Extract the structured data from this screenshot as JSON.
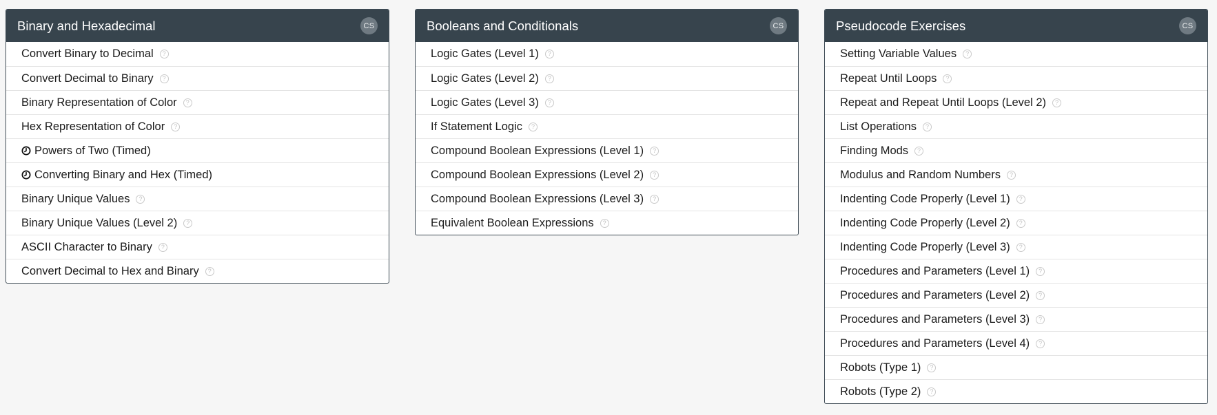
{
  "panels": [
    {
      "title": "Binary and Hexadecimal",
      "badge": "CS",
      "items": [
        {
          "label": "Convert Binary to Decimal",
          "help": true,
          "timed": false
        },
        {
          "label": "Convert Decimal to Binary",
          "help": true,
          "timed": false
        },
        {
          "label": "Binary Representation of Color",
          "help": true,
          "timed": false
        },
        {
          "label": "Hex Representation of Color",
          "help": true,
          "timed": false
        },
        {
          "label": "Powers of Two (Timed)",
          "help": false,
          "timed": true
        },
        {
          "label": "Converting Binary and Hex (Timed)",
          "help": false,
          "timed": true
        },
        {
          "label": "Binary Unique Values",
          "help": true,
          "timed": false
        },
        {
          "label": "Binary Unique Values (Level 2)",
          "help": true,
          "timed": false
        },
        {
          "label": "ASCII Character to Binary",
          "help": true,
          "timed": false
        },
        {
          "label": "Convert Decimal to Hex and Binary",
          "help": true,
          "timed": false
        }
      ]
    },
    {
      "title": "Booleans and Conditionals",
      "badge": "CS",
      "items": [
        {
          "label": "Logic Gates (Level 1)",
          "help": true,
          "timed": false
        },
        {
          "label": "Logic Gates (Level 2)",
          "help": true,
          "timed": false
        },
        {
          "label": "Logic Gates (Level 3)",
          "help": true,
          "timed": false
        },
        {
          "label": "If Statement Logic",
          "help": true,
          "timed": false
        },
        {
          "label": "Compound Boolean Expressions (Level 1)",
          "help": true,
          "timed": false
        },
        {
          "label": "Compound Boolean Expressions (Level 2)",
          "help": true,
          "timed": false
        },
        {
          "label": "Compound Boolean Expressions (Level 3)",
          "help": true,
          "timed": false
        },
        {
          "label": "Equivalent Boolean Expressions",
          "help": true,
          "timed": false
        }
      ]
    },
    {
      "title": "Pseudocode Exercises",
      "badge": "CS",
      "items": [
        {
          "label": "Setting Variable Values",
          "help": true,
          "timed": false
        },
        {
          "label": "Repeat Until Loops",
          "help": true,
          "timed": false
        },
        {
          "label": "Repeat and Repeat Until Loops (Level 2)",
          "help": true,
          "timed": false
        },
        {
          "label": "List Operations",
          "help": true,
          "timed": false
        },
        {
          "label": "Finding Mods",
          "help": true,
          "timed": false
        },
        {
          "label": "Modulus and Random Numbers",
          "help": true,
          "timed": false
        },
        {
          "label": "Indenting Code Properly (Level 1)",
          "help": true,
          "timed": false
        },
        {
          "label": "Indenting Code Properly (Level 2)",
          "help": true,
          "timed": false
        },
        {
          "label": "Indenting Code Properly (Level 3)",
          "help": true,
          "timed": false
        },
        {
          "label": "Procedures and Parameters (Level 1)",
          "help": true,
          "timed": false
        },
        {
          "label": "Procedures and Parameters (Level 2)",
          "help": true,
          "timed": false
        },
        {
          "label": "Procedures and Parameters (Level 3)",
          "help": true,
          "timed": false
        },
        {
          "label": "Procedures and Parameters (Level 4)",
          "help": true,
          "timed": false
        },
        {
          "label": "Robots (Type 1)",
          "help": true,
          "timed": false
        },
        {
          "label": "Robots (Type 2)",
          "help": true,
          "timed": false
        }
      ]
    }
  ],
  "icons": {
    "help": "question-circle-icon",
    "timed": "clock-icon",
    "help_glyph": "?"
  },
  "colors": {
    "header_bg": "#37444d",
    "badge_bg": "#6f7a82",
    "page_bg": "#f6f6f6"
  }
}
